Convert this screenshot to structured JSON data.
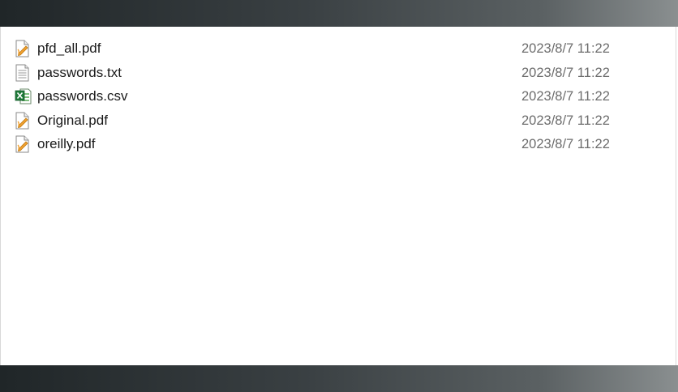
{
  "files": [
    {
      "name": "pfd_all.pdf",
      "modified": "2023/8/7 11:22",
      "icon": "pdf-icon"
    },
    {
      "name": "passwords.txt",
      "modified": "2023/8/7 11:22",
      "icon": "text-file-icon"
    },
    {
      "name": "passwords.csv",
      "modified": "2023/8/7 11:22",
      "icon": "excel-csv-icon"
    },
    {
      "name": "Original.pdf",
      "modified": "2023/8/7 11:22",
      "icon": "pdf-icon"
    },
    {
      "name": "oreilly.pdf",
      "modified": "2023/8/7 11:22",
      "icon": "pdf-icon"
    }
  ],
  "colors": {
    "pdf_accent": "#f0a030",
    "excel_green": "#1f7a3a",
    "text_color": "#1a1a1a",
    "date_color": "#6d6d6d"
  }
}
